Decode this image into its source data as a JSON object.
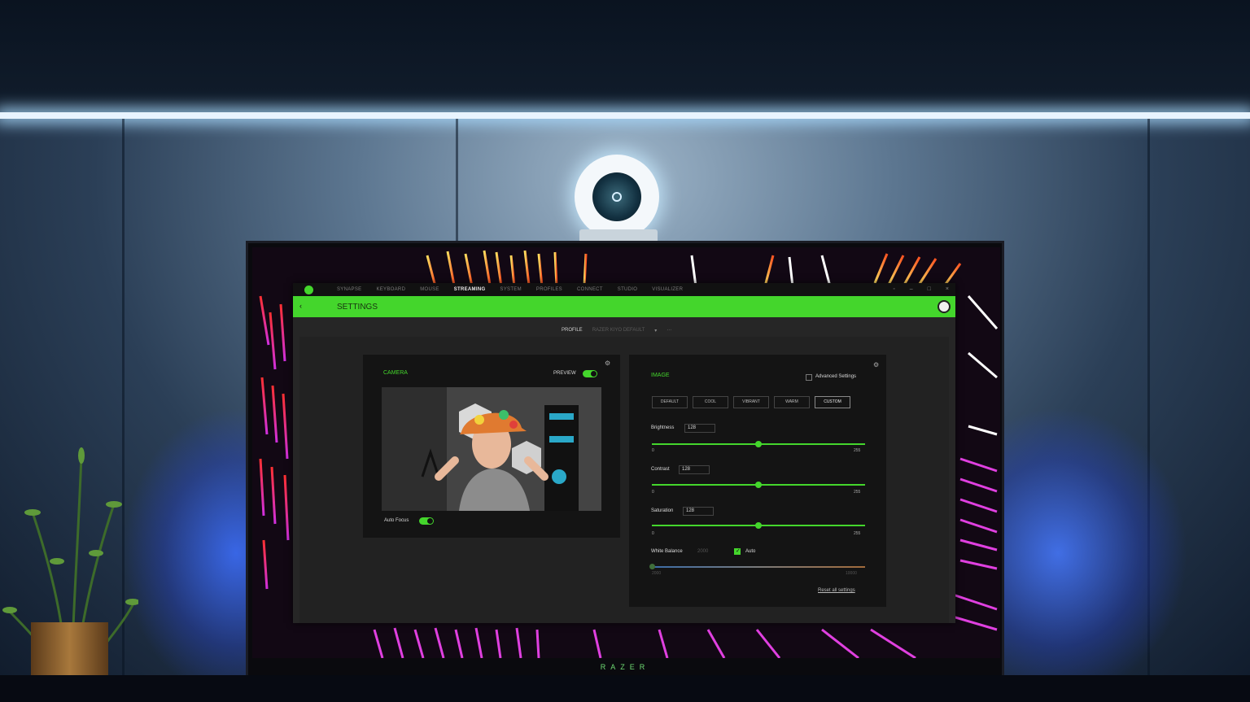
{
  "scene": {
    "monitor_brand": "RAZER"
  },
  "app": {
    "tabs": [
      "SYNAPSE",
      "KEYBOARD",
      "MOUSE",
      "STREAMING",
      "SYSTEM",
      "PROFILES",
      "CONNECT",
      "STUDIO",
      "VISUALIZER"
    ],
    "active_tab": "STREAMING",
    "window_controls": [
      "◦",
      "–",
      "□",
      "×"
    ],
    "header": {
      "back_icon": "chevron-left-icon",
      "title": "SETTINGS"
    },
    "profile": {
      "label": "PROFILE",
      "value": "RAZER KIYO DEFAULT",
      "caret": "▾",
      "more": "···"
    },
    "camera_panel": {
      "title": "CAMERA",
      "preview_label": "PREVIEW",
      "preview_on": true,
      "auto_focus_label": "Auto Focus",
      "auto_focus_on": true
    },
    "image_panel": {
      "title": "IMAGE",
      "advanced_label": "Advanced Settings",
      "advanced_checked": false,
      "presets": [
        "DEFAULT",
        "COOL",
        "VIBRANT",
        "WARM",
        "CUSTOM"
      ],
      "active_preset": "CUSTOM",
      "sliders": [
        {
          "label": "Brightness",
          "value": "128",
          "min": "0",
          "max": "255",
          "fraction": 0.5
        },
        {
          "label": "Contrast",
          "value": "128",
          "min": "0",
          "max": "255",
          "fraction": 0.5
        },
        {
          "label": "Saturation",
          "value": "128",
          "min": "0",
          "max": "255",
          "fraction": 0.5
        }
      ],
      "white_balance": {
        "label": "White Balance",
        "value": "2000",
        "auto_label": "Auto",
        "auto_checked": true,
        "min": "2000",
        "max": "10000",
        "fraction": 0.0
      },
      "reset_label": "Reset all settings"
    },
    "colors": {
      "accent": "#44d62c",
      "panel": "#141414",
      "background": "#262626"
    }
  }
}
